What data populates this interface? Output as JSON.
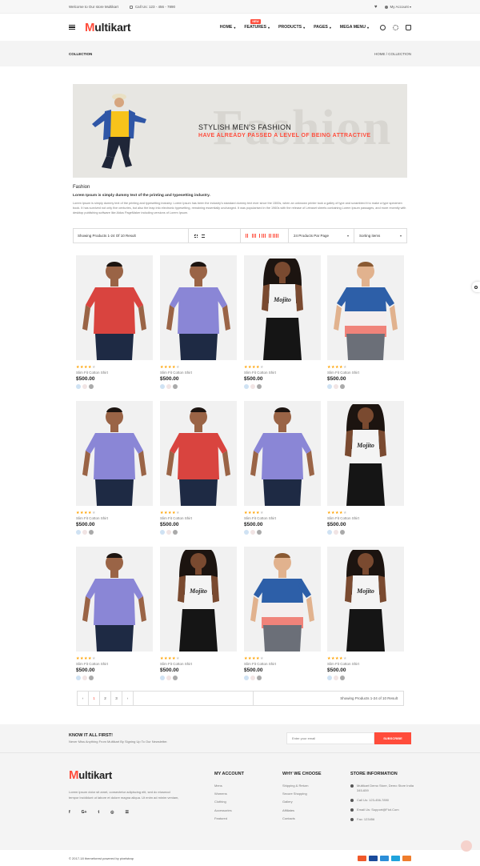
{
  "topbar": {
    "welcome": "Welcome to Our store Multikart",
    "phone": "Call Us: 123 - 456 - 7890",
    "account": "My Account"
  },
  "header": {
    "logo_first": "M",
    "logo_rest": "ultikart",
    "nav": [
      "HOME",
      "FEATURES",
      "PRODUCTS",
      "PAGES",
      "MEGA MENU"
    ],
    "new_badge": "NEW"
  },
  "breadcrumb": {
    "title": "COLLECTION",
    "path": "HOME / COLLECTION"
  },
  "banner": {
    "bg_word": "Fashion",
    "line1": "STYLISH MEN'S FASHION",
    "line2": "HAVE ALREADY PASSED A LEVEL OF BEING ATTRACTIVE"
  },
  "description": {
    "heading": "Fashion",
    "subheading": "Lorem Ipsum is simply dummy text of the printing and typesetting industry.",
    "body": "Lorem Ipsum is simply dummy text of the printing and typesetting industry. Lorem Ipsum has been the industry's standard dummy text ever since the 1500s, when an unknown printer took a galley of type and scrambled it to make a type specimen book. It has survived not only five centuries, but also the leap into electronic typesetting, remaining essentially unchanged. It was popularised in the 1960s with the release of Letraset sheets containing Lorem Ipsum passages, and more recently with desktop publishing software like Aldus PageMaker including versions of Lorem Ipsum."
  },
  "toolbar": {
    "result_count": "Showing Products 1-24 Of 10 Result",
    "per_page": "24 Products Par Page",
    "sort": "Sorting items"
  },
  "products": [
    {
      "name": "Slim Fit Cotton Shirt",
      "price": "$500.00",
      "rating": 4,
      "model": "man",
      "shirt": "#d9443f"
    },
    {
      "name": "Slim Fit Cotton Shirt",
      "price": "$500.00",
      "rating": 4,
      "model": "man",
      "shirt": "#8a86d6"
    },
    {
      "name": "Slim Fit Cotton Shirt",
      "price": "$500.00",
      "rating": 4,
      "model": "woman",
      "shirt": "#f4f4f4"
    },
    {
      "name": "Slim Fit Cotton Shirt",
      "price": "$500.00",
      "rating": 4,
      "model": "man2",
      "shirt": "#2d5fa8"
    },
    {
      "name": "Slim Fit Cotton Shirt",
      "price": "$500.00",
      "rating": 4,
      "model": "man",
      "shirt": "#8a86d6"
    },
    {
      "name": "Slim Fit Cotton Shirt",
      "price": "$500.00",
      "rating": 4,
      "model": "man",
      "shirt": "#d9443f"
    },
    {
      "name": "Slim Fit Cotton Shirt",
      "price": "$500.00",
      "rating": 4,
      "model": "man",
      "shirt": "#8a86d6"
    },
    {
      "name": "Slim Fit Cotton Shirt",
      "price": "$500.00",
      "rating": 4,
      "model": "woman",
      "shirt": "#f4f4f4"
    },
    {
      "name": "Slim Fit Cotton Shirt",
      "price": "$500.00",
      "rating": 4,
      "model": "man",
      "shirt": "#8a86d6"
    },
    {
      "name": "Slim Fit Cotton Shirt",
      "price": "$500.00",
      "rating": 4,
      "model": "woman",
      "shirt": "#f4f4f4"
    },
    {
      "name": "Slim Fit Cotton Shirt",
      "price": "$500.00",
      "rating": 4,
      "model": "man2",
      "shirt": "#2d5fa8"
    },
    {
      "name": "Slim Fit Cotton Shirt",
      "price": "$500.00",
      "rating": 4,
      "model": "woman",
      "shirt": "#f4f4f4"
    }
  ],
  "swatches": [
    "#cfe2f3",
    "#f1e4e4",
    "#aaaaaa"
  ],
  "pagination": {
    "pages": [
      "1",
      "2",
      "3"
    ],
    "active": "1",
    "result_count": "Showing Products 1-24 of 10 Result"
  },
  "newsletter": {
    "title": "KNOW IT ALL FIRST!",
    "subtitle": "Never Miss Anything From Multikart By Signing Up To Our Newsletter.",
    "placeholder": "Enter your email",
    "button": "SUBSCRIBE"
  },
  "footer": {
    "about": "Lorem ipsum dolor sit amet, consectetur adipiscing elit, sed do eiusmod tempor incididunt ut labore et dolore magna aliqua. Ut enim ad minim veniam,",
    "social": [
      "f",
      "G+",
      "t",
      "◎",
      "☰"
    ],
    "my_account": {
      "title": "MY ACCOUNT",
      "items": [
        "Mens",
        "Womens",
        "Clothing",
        "Accessories",
        "Featured"
      ]
    },
    "why_we_choose": {
      "title": "WHY WE CHOOSE",
      "items": [
        "Shipping & Return",
        "Secure Shopping",
        "Gallery",
        "Affiliates",
        "Contacts"
      ]
    },
    "store_info": {
      "title": "STORE INFORMATION",
      "items": [
        "Multikart Demo Store, Demo Store India 345-659",
        "Call Us: 123-456-7890",
        "Email Us: Support@Fiot.Com",
        "Fax: 123456"
      ]
    },
    "copyright": "© 2017-18 themeforest powered by pixelstrap"
  },
  "colors": {
    "accent": "#ff4c3b",
    "star": "#ffa200"
  }
}
